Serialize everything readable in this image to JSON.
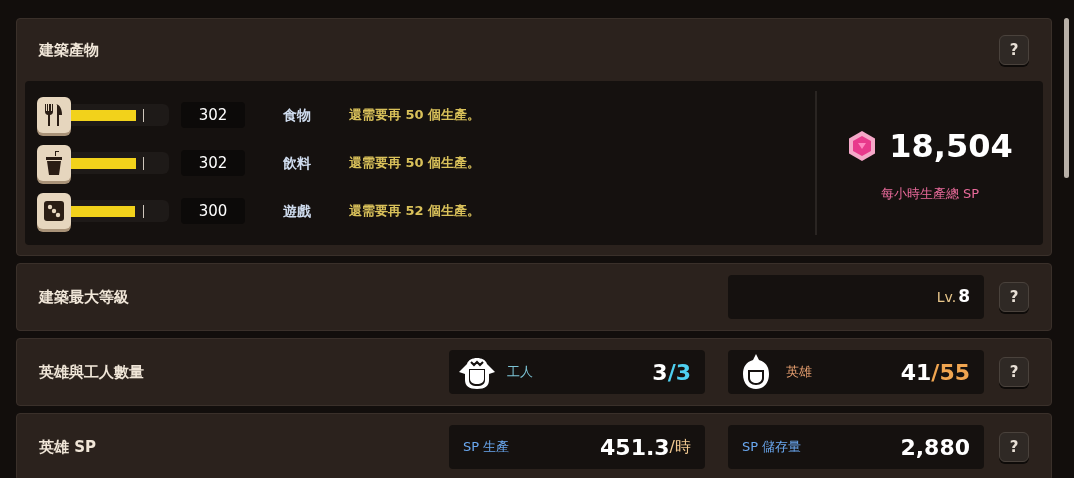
{
  "production": {
    "title": "建築產物",
    "help": "?",
    "items": [
      {
        "kind": "food",
        "level": 0.67,
        "count": "302",
        "name": "食物",
        "note": "還需要再 50 個生產。"
      },
      {
        "kind": "drink",
        "level": 0.67,
        "count": "302",
        "name": "飲料",
        "note": "還需要再 50 個生產。"
      },
      {
        "kind": "game",
        "level": 0.66,
        "count": "300",
        "name": "遊戲",
        "note": "還需要再 52 個生產。"
      }
    ],
    "total": {
      "value": "18,504",
      "label": "每小時生產總 SP"
    }
  },
  "max_level": {
    "title": "建築最大等級",
    "prefix": "Lv.",
    "value": "8",
    "help": "?"
  },
  "units": {
    "title": "英雄與工人數量",
    "help": "?",
    "groups": [
      {
        "kind": "worker",
        "label": "工人",
        "current": "3",
        "max": "/3"
      },
      {
        "kind": "hero",
        "label": "英雄",
        "current": "41",
        "max": "/55"
      }
    ]
  },
  "hero_sp": {
    "title": "英雄 SP",
    "help": "?",
    "production": {
      "label": "SP 生產",
      "value": "451.3",
      "unit": "/時"
    },
    "storage": {
      "label": "SP 儲存量",
      "value": "2,880"
    }
  }
}
